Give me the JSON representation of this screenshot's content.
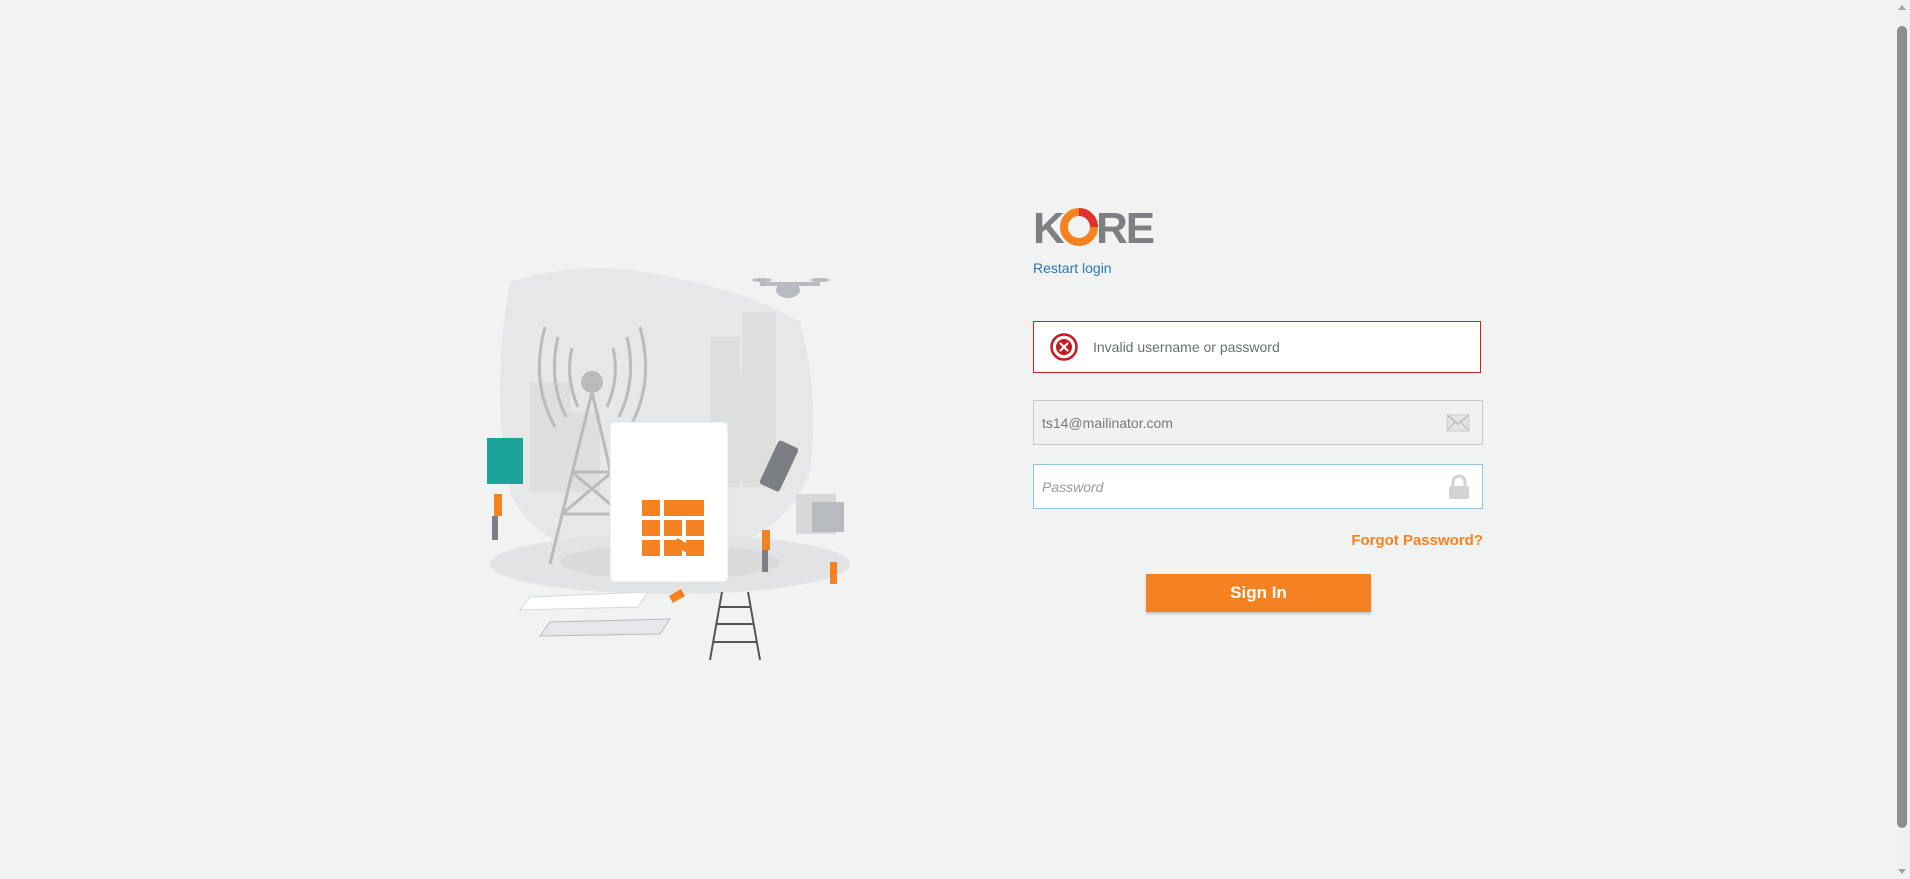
{
  "logo": {
    "text": "KORE"
  },
  "login": {
    "restart_label": "Restart login",
    "error_message": "Invalid username or password",
    "email_value": "ts14@mailinator.com",
    "password_placeholder": "Password",
    "forgot_label": "Forgot Password?",
    "signin_label": "Sign In"
  },
  "icons": {
    "error": "error-x-icon",
    "email": "envelope-icon",
    "password": "lock-icon"
  },
  "colors": {
    "accent": "#f58220",
    "link": "#2b78b5",
    "error": "#d0211f",
    "background": "#f1f2f2"
  }
}
